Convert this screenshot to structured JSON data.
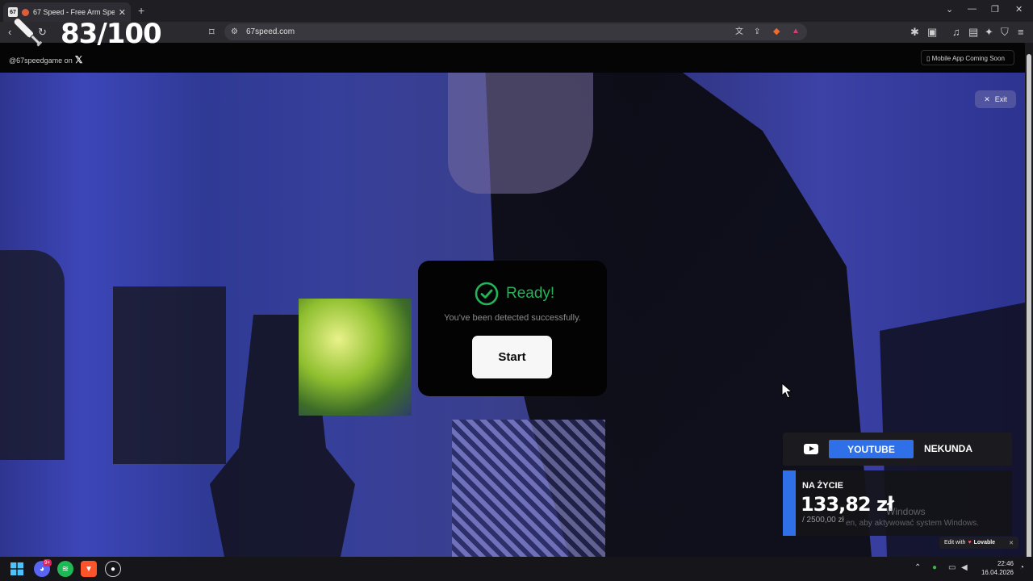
{
  "browser": {
    "tab": {
      "favicon_text": "67",
      "title": "67 Speed - Free Arm Speed C",
      "close": "✕"
    },
    "new_tab": "+",
    "window_controls": {
      "tabs_menu": "⌄",
      "minimize": "—",
      "maximize": "❐",
      "close": "✕"
    },
    "url": "67speed.com"
  },
  "overlay": {
    "score": "83/100"
  },
  "game": {
    "handle": "@67speedgame on",
    "x_logo": "𝕏",
    "mobile_notice": "Mobile App Coming Soon",
    "exit_label": "Exit"
  },
  "dialog": {
    "title": "Ready!",
    "subtitle": "You've been detected successfully.",
    "start_label": "Start"
  },
  "stream_widget": {
    "youtube_label": "YOUTUBE",
    "nekunda_label": "NEKUNDA",
    "live_label": "NA ŻYCIE",
    "amount": "133,82 zł",
    "goal": "/ 2500,00 zł",
    "windows_activation_title": "Windows",
    "windows_activation_text": "en, aby aktywować system Windows."
  },
  "lovable": {
    "prefix": "Edit with",
    "brand": "Lovable",
    "close": "✕"
  },
  "taskbar": {
    "time": "22:46",
    "date": "16.04.2026",
    "discord_badge": "9+"
  },
  "colors": {
    "ready_green": "#25b25a",
    "youtube_blue": "#2f6fe8",
    "dialog_bg": "#030303"
  }
}
